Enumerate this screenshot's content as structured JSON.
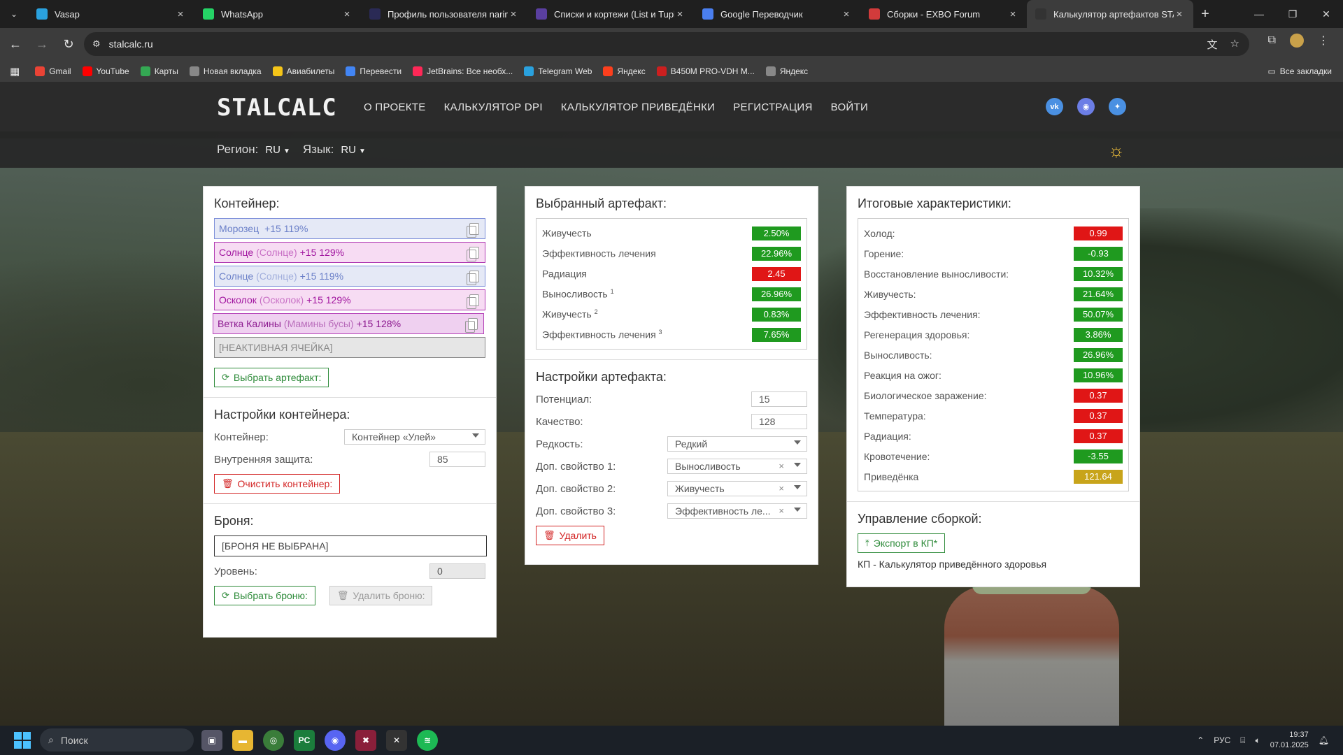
{
  "browser": {
    "tabs": [
      {
        "label": "Vasap",
        "color": "#2aa1de"
      },
      {
        "label": "WhatsApp",
        "color": "#25d366"
      },
      {
        "label": "Профиль пользователя narim",
        "color": "#2a2a55"
      },
      {
        "label": "Списки и кортежи (List и Tuple",
        "color": "#5a3fa0"
      },
      {
        "label": "Google Переводчик",
        "color": "#4a7ff0"
      },
      {
        "label": "Сборки - EXBO Forum",
        "color": "#d23b3b"
      },
      {
        "label": "Калькулятор артефактов STAL",
        "color": "#333333",
        "active": true
      }
    ],
    "url": "stalcalc.ru",
    "bookmarks": [
      {
        "label": "Gmail",
        "color": "#ea4335"
      },
      {
        "label": "YouTube",
        "color": "#ff0000"
      },
      {
        "label": "Карты",
        "color": "#34a853"
      },
      {
        "label": "Новая вкладка",
        "color": "#888888"
      },
      {
        "label": "Авиабилеты",
        "color": "#f5c518"
      },
      {
        "label": "Перевести",
        "color": "#4285f4"
      },
      {
        "label": "JetBrains: Все необх...",
        "color": "#fe2857"
      },
      {
        "label": "Telegram Web",
        "color": "#2aa1de"
      },
      {
        "label": "Яндекс",
        "color": "#fc3f1d"
      },
      {
        "label": "B450M PRO-VDH M...",
        "color": "#cc1f1f"
      },
      {
        "label": "Яндекс",
        "color": "#888888"
      }
    ],
    "all_bookmarks": "Все закладки"
  },
  "site": {
    "logo": "STALCALC",
    "menu": [
      "О ПРОЕКТЕ",
      "КАЛЬКУЛЯТОР DPI",
      "КАЛЬКУЛЯТОР ПРИВЕДЁНКИ",
      "РЕГИСТРАЦИЯ",
      "ВОЙТИ"
    ],
    "social": [
      "vk",
      "discord",
      "twitter"
    ],
    "region_label": "Регион:",
    "region_value": "RU",
    "lang_label": "Язык:",
    "lang_value": "RU"
  },
  "container": {
    "title": "Контейнер:",
    "slots": [
      {
        "name": "Морозец",
        "sub": "",
        "level": "+15 119%",
        "style": "blue"
      },
      {
        "name": "Солнце",
        "sub": "(Солнце)",
        "level": "+15 129%",
        "style": "pink"
      },
      {
        "name": "Солнце",
        "sub": "(Солнце)",
        "level": "+15 119%",
        "style": "blue"
      },
      {
        "name": "Осколок",
        "sub": "(Осколок)",
        "level": "+15 129%",
        "style": "pink"
      },
      {
        "name": "Ветка Калины",
        "sub": "(Мамины бусы)",
        "level": "+15 128%",
        "style": "violet"
      }
    ],
    "inactive_slot": "[НЕАКТИВНАЯ ЯЧЕЙКА]",
    "choose_artifact": "Выбрать артефакт:",
    "settings_title": "Настройки контейнера:",
    "container_label": "Контейнер:",
    "container_value": "Контейнер «Улей»",
    "protection_label": "Внутренняя защита:",
    "protection_value": "85",
    "clear_btn": "Очистить контейнер:",
    "armor_title": "Броня:",
    "armor_value": "[БРОНЯ НЕ ВЫБРАНА]",
    "level_label": "Уровень:",
    "level_value": "0",
    "choose_armor": "Выбрать броню:",
    "delete_armor": "Удалить броню:"
  },
  "artifact": {
    "title": "Выбранный артефакт:",
    "stats": [
      {
        "label": "Живучесть",
        "sup": "",
        "value": "2.50%",
        "color": "g"
      },
      {
        "label": "Эффективность лечения",
        "sup": "",
        "value": "22.96%",
        "color": "g"
      },
      {
        "label": "Радиация",
        "sup": "",
        "value": "2.45",
        "color": "r"
      },
      {
        "label": "Выносливость",
        "sup": "1",
        "value": "26.96%",
        "color": "g"
      },
      {
        "label": "Живучесть",
        "sup": "2",
        "value": "0.83%",
        "color": "g"
      },
      {
        "label": "Эффективность лечения",
        "sup": "3",
        "value": "7.65%",
        "color": "g"
      }
    ],
    "settings_title": "Настройки артефакта:",
    "potential_label": "Потенциал:",
    "potential_value": "15",
    "quality_label": "Качество:",
    "quality_value": "128",
    "rarity_label": "Редкость:",
    "rarity_value": "Редкий",
    "extra1_label": "Доп. свойство 1:",
    "extra1_value": "Выносливость",
    "extra2_label": "Доп. свойство 2:",
    "extra2_value": "Живучесть",
    "extra3_label": "Доп. свойство 3:",
    "extra3_value": "Эффективность ле...",
    "delete_btn": "Удалить"
  },
  "totals": {
    "title": "Итоговые характеристики:",
    "stats": [
      {
        "label": "Холод:",
        "value": "0.99",
        "color": "r"
      },
      {
        "label": "Горение:",
        "value": "-0.93",
        "color": "g"
      },
      {
        "label": "Восстановление выносливости:",
        "value": "10.32%",
        "color": "g"
      },
      {
        "label": "Живучесть:",
        "value": "21.64%",
        "color": "g"
      },
      {
        "label": "Эффективность лечения:",
        "value": "50.07%",
        "color": "g"
      },
      {
        "label": "Регенерация здоровья:",
        "value": "3.86%",
        "color": "g"
      },
      {
        "label": "Выносливость:",
        "value": "26.96%",
        "color": "g"
      },
      {
        "label": "Реакция на ожог:",
        "value": "10.96%",
        "color": "g"
      },
      {
        "label": "Биологическое заражение:",
        "value": "0.37",
        "color": "r"
      },
      {
        "label": "Температура:",
        "value": "0.37",
        "color": "r"
      },
      {
        "label": "Радиация:",
        "value": "0.37",
        "color": "r"
      },
      {
        "label": "Кровотечение:",
        "value": "-3.55",
        "color": "g"
      },
      {
        "label": "Приведёнка",
        "value": "121.64",
        "color": "y"
      }
    ],
    "manage_title": "Управление сборкой:",
    "export_btn": "Экспорт в КП*",
    "footnote": "КП - Калькулятор приведённого здоровья"
  },
  "taskbar": {
    "search": "Поиск",
    "lang": "РУС",
    "time": "19:37",
    "date": "07.01.2025"
  }
}
